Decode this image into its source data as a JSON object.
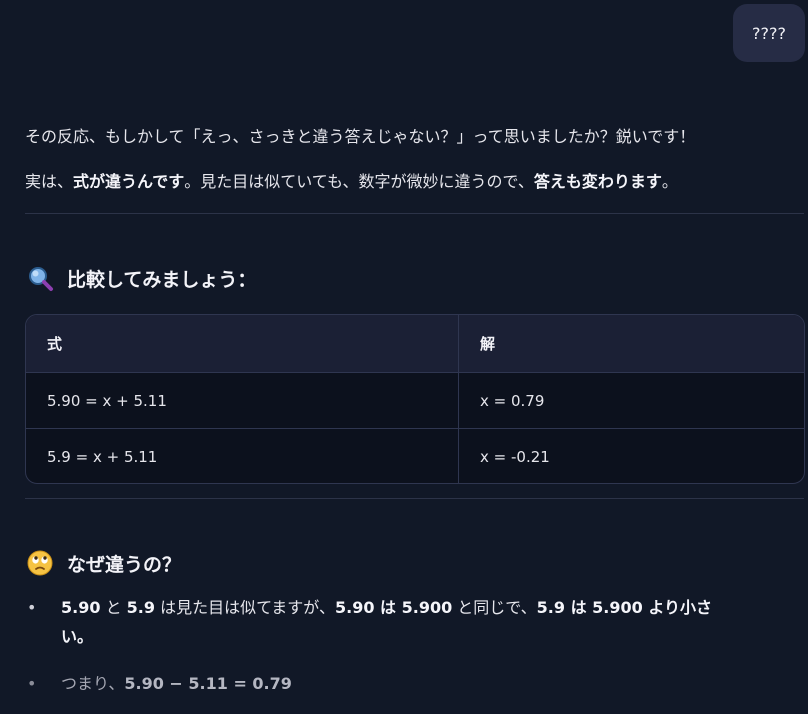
{
  "user_message": "????",
  "assistant": {
    "p1": "その反応、もしかして「えっ、さっきと違う答えじゃない？」って思いましたか？鋭いです！",
    "p2": {
      "t1": "実は、",
      "b1": "式が違うんです",
      "t2": "。見た目は似ていても、数字が微妙に違うので、",
      "b2": "答えも変わります",
      "t3": "。"
    },
    "section1": {
      "icon": "magnifying-glass-icon",
      "title": "比較してみましょう："
    },
    "table": {
      "headers": [
        "式",
        "解"
      ],
      "rows": [
        [
          "5.90 = x + 5.11",
          "x = 0.79"
        ],
        [
          "5.9 = x + 5.11",
          "x = -0.21"
        ]
      ]
    },
    "section2": {
      "icon": "face-with-rolling-eyes-icon",
      "title": "なぜ違うの？"
    },
    "bullets": {
      "b1": {
        "s1": "5.90",
        "t1": " と ",
        "s2": "5.9",
        "t2": " は見た目は似てますが、",
        "s3": "5.90 は 5.900",
        "t3": " と同じで、",
        "s4": "5.9 は 5.900 より小さ",
        "line2": "い。"
      },
      "b2": {
        "t1": "つまり、",
        "s1": "5.90 − 5.11 = 0.79"
      }
    }
  },
  "colors": {
    "background": "#111827",
    "user_bubble": "#262c45",
    "table_header": "#1b2035",
    "table_body": "#0c111d",
    "divider": "#2c3348"
  }
}
